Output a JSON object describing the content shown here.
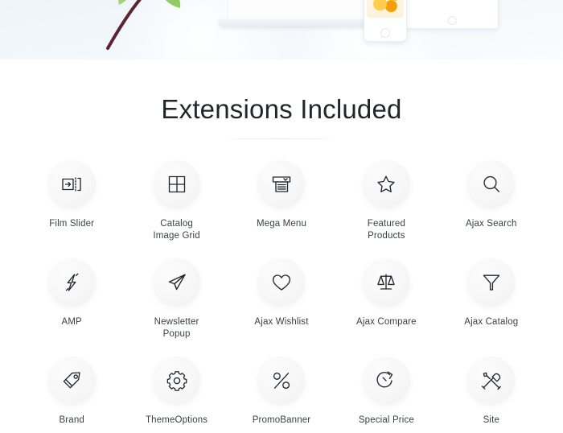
{
  "hero": {
    "background_color": "#eef4fa",
    "objects": [
      {
        "name": "mint-sprig",
        "description": "green mint leaves on dark stem"
      },
      {
        "name": "laptop-mockup",
        "description": "white laptop viewed from front"
      },
      {
        "name": "phone-mockup",
        "description": "white smartphone showing orange food photo"
      },
      {
        "name": "tablet-mockup",
        "description": "white tablet showing store page"
      }
    ]
  },
  "section": {
    "title": "Extensions Included",
    "title_color": "#22262b",
    "label_color": "#3c4146",
    "circle_color": "#f7f7f7"
  },
  "extensions": [
    {
      "label": "Film Slider",
      "icon": "film-slider-icon"
    },
    {
      "label": "Catalog\nImage Grid",
      "icon": "grid-icon"
    },
    {
      "label": "Mega Menu",
      "icon": "mega-menu-icon"
    },
    {
      "label": "Featured\nProducts",
      "icon": "star-icon"
    },
    {
      "label": "Ajax Search",
      "icon": "search-icon"
    },
    {
      "label": "AMP",
      "icon": "lightning-bolt-icon"
    },
    {
      "label": "Newsletter\nPopup",
      "icon": "paper-plane-icon"
    },
    {
      "label": "Ajax Wishlist",
      "icon": "heart-icon"
    },
    {
      "label": "Ajax Compare",
      "icon": "balance-scale-icon"
    },
    {
      "label": "Ajax Catalog",
      "icon": "funnel-icon"
    },
    {
      "label": "Brand",
      "icon": "price-tag-icon"
    },
    {
      "label": "ThemeOptions",
      "icon": "gear-icon"
    },
    {
      "label": "PromoBanner",
      "icon": "percent-icon"
    },
    {
      "label": "Special Price",
      "icon": "stopwatch-icon"
    },
    {
      "label": "Site",
      "icon": "hammer-wrench-icon"
    }
  ]
}
